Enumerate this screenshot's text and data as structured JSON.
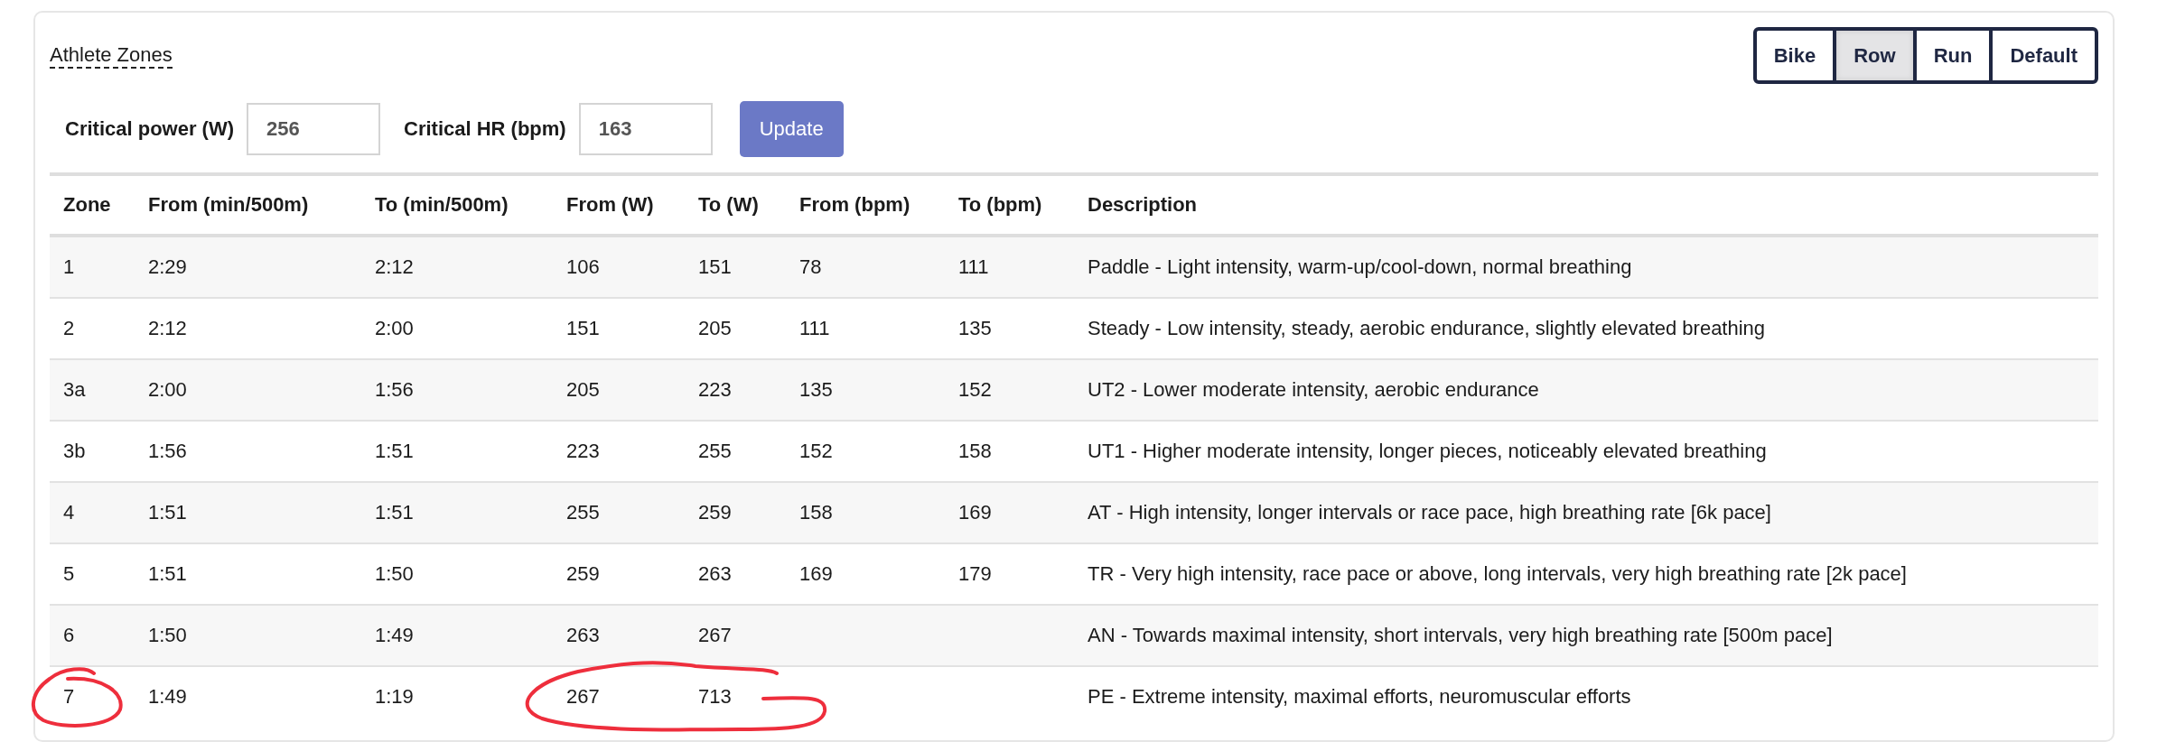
{
  "panel": {
    "title": "Athlete Zones"
  },
  "sport_tabs": [
    {
      "label": "Bike",
      "selected": false
    },
    {
      "label": "Row",
      "selected": true
    },
    {
      "label": "Run",
      "selected": false
    },
    {
      "label": "Default",
      "selected": false
    }
  ],
  "thresholds": [
    {
      "label": "Critical power (W)",
      "value": "256"
    },
    {
      "label": "Critical HR (bpm)",
      "value": "163"
    }
  ],
  "update_button": "Update",
  "table": {
    "columns": [
      "Zone",
      "From (min/500m)",
      "To (min/500m)",
      "From (W)",
      "To (W)",
      "From (bpm)",
      "To (bpm)",
      "Description"
    ],
    "rows": [
      [
        "1",
        "2:29",
        "2:12",
        "106",
        "151",
        "78",
        "111",
        "Paddle - Light intensity, warm-up/cool-down, normal breathing"
      ],
      [
        "2",
        "2:12",
        "2:00",
        "151",
        "205",
        "111",
        "135",
        "Steady - Low intensity, steady, aerobic endurance, slightly elevated breathing"
      ],
      [
        "3a",
        "2:00",
        "1:56",
        "205",
        "223",
        "135",
        "152",
        "UT2 - Lower moderate intensity, aerobic endurance"
      ],
      [
        "3b",
        "1:56",
        "1:51",
        "223",
        "255",
        "152",
        "158",
        "UT1 - Higher moderate intensity, longer pieces, noticeably elevated breathing"
      ],
      [
        "4",
        "1:51",
        "1:51",
        "255",
        "259",
        "158",
        "169",
        "AT - High intensity, longer intervals or race pace, high breathing rate [6k pace]"
      ],
      [
        "5",
        "1:51",
        "1:50",
        "259",
        "263",
        "169",
        "179",
        "TR - Very high intensity, race pace or above, long intervals, very high breathing rate [2k pace]"
      ],
      [
        "6",
        "1:50",
        "1:49",
        "263",
        "267",
        "",
        "",
        "AN - Towards maximal intensity, short intervals, very high breathing rate [500m pace]"
      ],
      [
        "7",
        "1:49",
        "1:19",
        "267",
        "713",
        "",
        "",
        "PE - Extreme intensity, maximal efforts, neuromuscular efforts"
      ]
    ]
  }
}
